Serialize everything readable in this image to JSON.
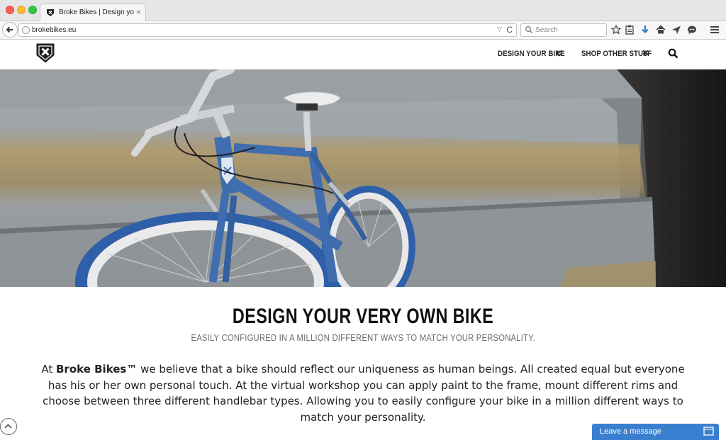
{
  "browser": {
    "tab_title": "Broke Bikes | Design your o...",
    "tab_close": "×",
    "url": "brokebikes.eu",
    "url_dropdown": "▽",
    "reload": "C",
    "search_placeholder": "Search"
  },
  "site": {
    "nav": [
      {
        "label": "DESIGN YOUR BIKE"
      },
      {
        "label": "SHOP OTHER STUFF"
      }
    ]
  },
  "content": {
    "headline": "DESIGN YOUR VERY OWN BIKE",
    "subheadline": "EASILY CONFIGURED IN A MILLION DIFFERENT WAYS TO MATCH YOUR PERSONALITY.",
    "body_prefix": "At ",
    "brand": "Broke Bikes™",
    "body_rest": " we believe that a bike should reflect our uniqueness as human beings. All created equal but everyone has his or her own personal touch. At the virtual workshop you can apply paint to the frame, mount different rims and choose between three different handlebar types. Allowing you to easily configure your bike in a million different ways to match your personality."
  },
  "chat": {
    "label": "Leave a message"
  },
  "colors": {
    "chat_bg": "#3a7fcf",
    "bike_frame": "#3f6db0",
    "nav_text": "#222222"
  },
  "icons": [
    "shield-logo-icon",
    "back-arrow-icon",
    "globe-icon",
    "reload-icon",
    "search-icon",
    "star-icon",
    "clipboard-icon",
    "download-icon",
    "home-icon",
    "send-icon",
    "chat-bubble-icon",
    "menu-icon",
    "chevron-double-down-icon",
    "chevron-up-icon",
    "message-icon"
  ]
}
